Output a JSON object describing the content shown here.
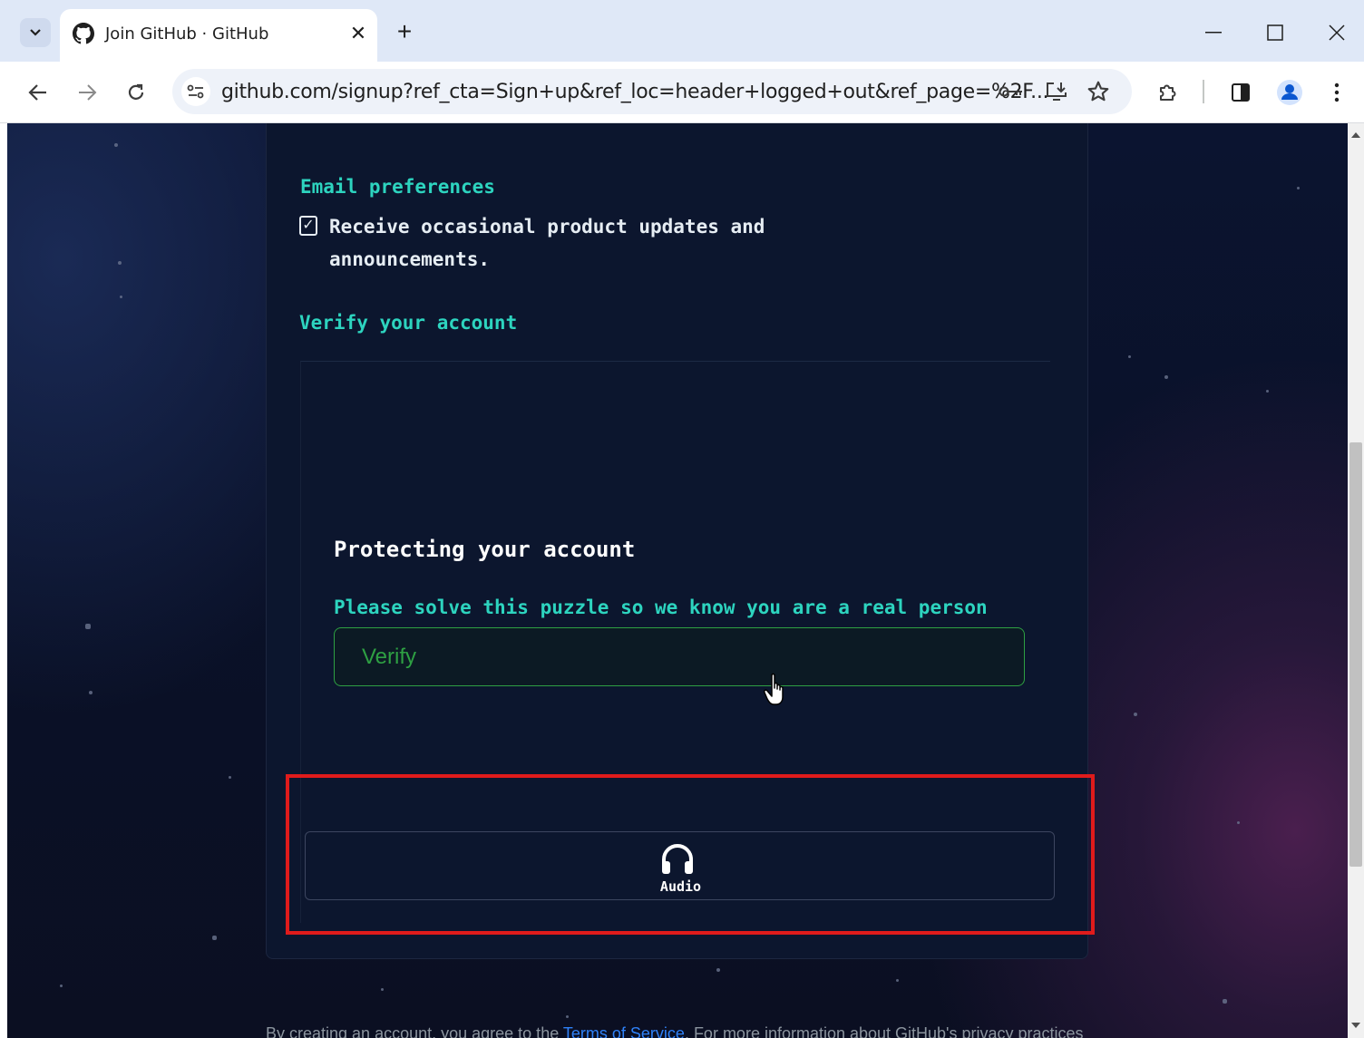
{
  "browser": {
    "tab_title": "Join GitHub · GitHub",
    "url": "github.com/signup?ref_cta=Sign+up&ref_loc=header+logged+out&ref_page=%2F..."
  },
  "form": {
    "email_prefs_label": "Email preferences",
    "email_prefs_checkbox_text": "Receive occasional product updates and announcements.",
    "email_prefs_checked": true,
    "verify_label": "Verify your account"
  },
  "captcha": {
    "title": "Protecting your account",
    "instruction": "Please solve this puzzle so we know you are a real person",
    "verify_button": "Verify",
    "audio_button": "Audio"
  },
  "footer": {
    "text_before": "By creating an account, you agree to the ",
    "terms_link": "Terms of Service",
    "text_after": ". For more information about GitHub's privacy practices"
  },
  "colors": {
    "accent_teal": "#2dd4bf",
    "verify_green": "#2ea043",
    "highlight_red": "#e01b1b"
  }
}
